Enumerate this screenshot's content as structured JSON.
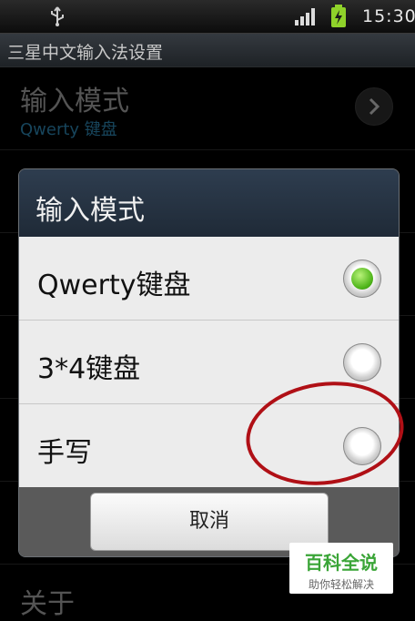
{
  "status_bar": {
    "time": "15:30",
    "icons": [
      "usb-icon",
      "signal-icon",
      "battery-charging-icon"
    ]
  },
  "app": {
    "title": "三星中文输入法设置"
  },
  "settings": {
    "input_mode": {
      "title": "输入模式",
      "value": "Qwerty 键盘"
    },
    "about": {
      "title": "关于"
    }
  },
  "dialog": {
    "title": "输入模式",
    "options": [
      {
        "label": "Qwerty键盘",
        "selected": true
      },
      {
        "label": "3*4键盘",
        "selected": false
      },
      {
        "label": "手写",
        "selected": false
      }
    ],
    "cancel_label": "取消"
  },
  "watermark": {
    "main": "百科全说",
    "sub": "助你轻松解决"
  },
  "colors": {
    "radio_selected": "#4fb51a",
    "annotation": "#b01016",
    "accent": "#2b7ea8"
  }
}
